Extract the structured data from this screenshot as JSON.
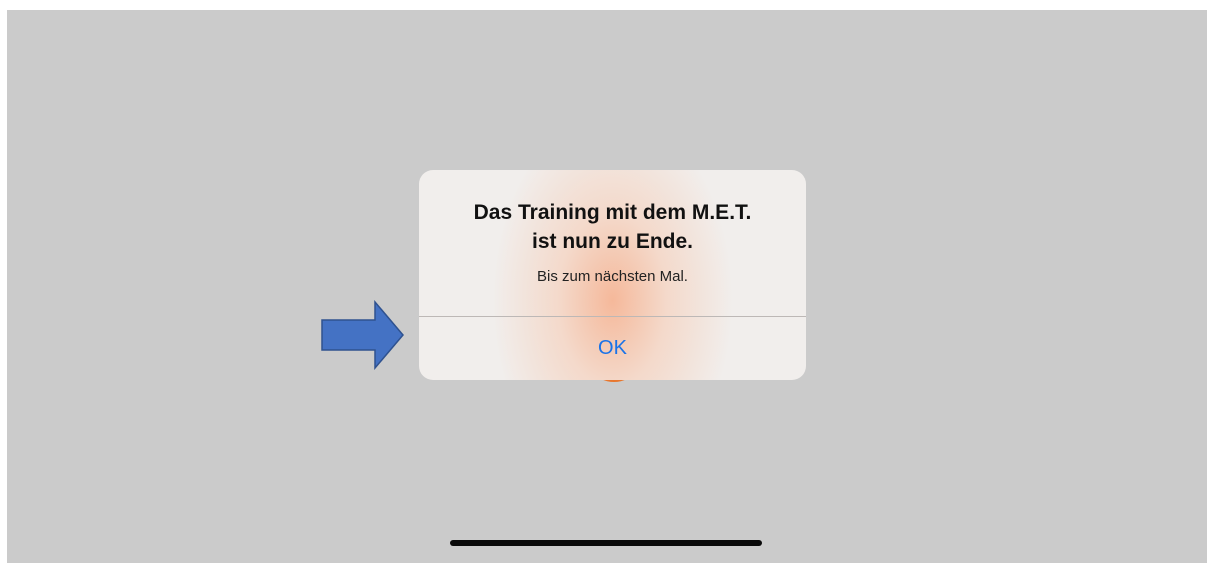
{
  "alert": {
    "title_line1": "Das Training mit dem M.E.T.",
    "title_line2": "ist nun zu Ende.",
    "message": "Bis zum nächsten Mal.",
    "ok_label": "OK"
  },
  "colors": {
    "screen_background": "#cbcbcb",
    "alert_background": "#f1eeec",
    "button_text": "#1a73e8",
    "arrow_fill": "#4472c4",
    "arrow_stroke": "#2f528f",
    "background_accent": "#e8772e"
  },
  "annotation": {
    "arrow_icon": "right-arrow-icon"
  }
}
